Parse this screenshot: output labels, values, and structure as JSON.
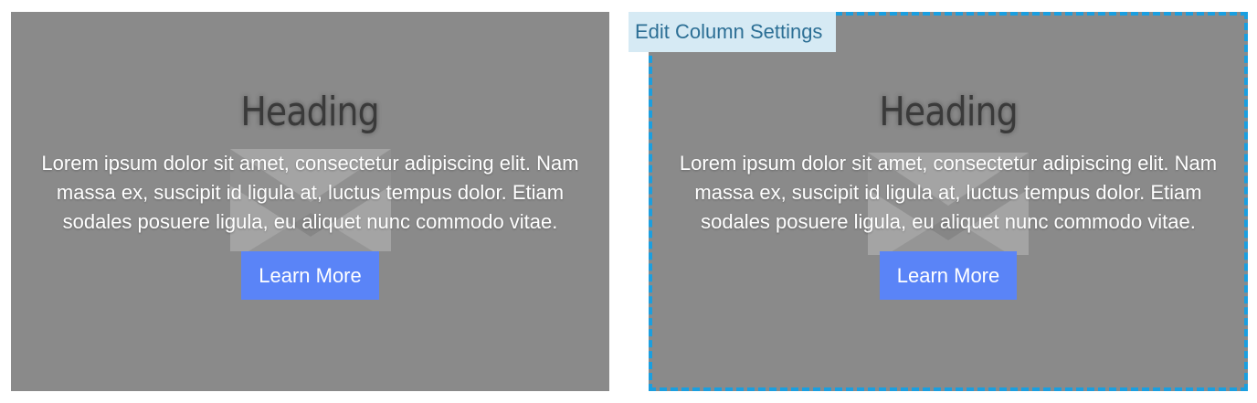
{
  "columns": [
    {
      "heading": "Heading",
      "body": "Lorem ipsum dolor sit amet, consectetur adipiscing elit. Nam massa ex, suscipit id ligula at, luctus tempus dolor. Etiam sodales posuere ligula, eu aliquet nunc commodo vitae.",
      "button_label": "Learn More"
    },
    {
      "heading": "Heading",
      "body": "Lorem ipsum dolor sit amet, consectetur adipiscing elit. Nam massa ex, suscipit id ligula at, luctus tempus dolor. Etiam sodales posuere ligula, eu aliquet nunc commodo vitae.",
      "button_label": "Learn More"
    }
  ],
  "editor": {
    "edit_tab_label": "Edit Column Settings"
  },
  "colors": {
    "column_background": "#8a8a8a",
    "button_background": "#5a84f7",
    "selection_border": "#1a9fe0",
    "edit_tab_background": "#d6eaf4",
    "edit_tab_text": "#2c6f95"
  },
  "icons": {
    "background_image": "image-placeholder-icon"
  }
}
